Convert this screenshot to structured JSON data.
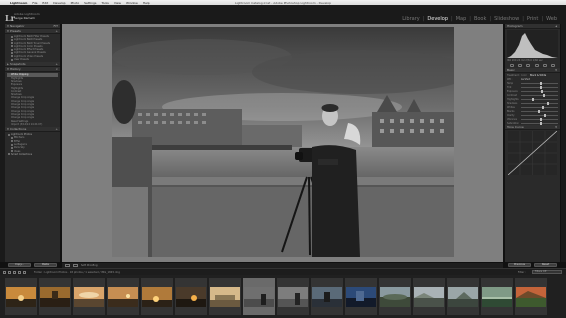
{
  "window": {
    "title": "Lightroom Catalog.lrcat - Adobe Photoshop Lightroom - Develop"
  },
  "menubar": {
    "apple_glyph": "",
    "items": [
      "Lightroom",
      "File",
      "Edit",
      "Develop",
      "Photo",
      "Settings",
      "Tools",
      "View",
      "Window",
      "Help"
    ]
  },
  "identity": {
    "logo": "Lr",
    "catalog_label": "Adobe Lightroom",
    "user_name": "Serge Ramelli"
  },
  "modules": {
    "items": [
      "Library",
      "Develop",
      "Map",
      "Book",
      "Slideshow",
      "Print",
      "Web"
    ],
    "active": "Develop"
  },
  "left_panel": {
    "navigator": {
      "label": "Navigator",
      "zoom": "FIT"
    },
    "presets": {
      "label": "Presets",
      "rows": [
        "Lightroom B&W Filter Presets",
        "Lightroom B&W Presets",
        "Lightroom B&W Toned Presets",
        "Lightroom Color Presets",
        "Lightroom Effect Presets",
        "Lightroom General Presets",
        "Lightroom Video Presets",
        "User Presets"
      ]
    },
    "snapshots": {
      "label": "Snapshots"
    },
    "history": {
      "label": "History",
      "rows": [
        "White Clipping",
        "Highlights",
        "Shadows",
        "Exposure",
        "Highlights",
        "Contrast",
        "Shadows",
        "Change Crop Angle",
        "Change Crop Angle",
        "Change Crop Angle",
        "Change Crop Angle",
        "Change Crop Angle",
        "Change Crop Angle",
        "Change Crop Angle",
        "Reset Settings",
        "Import (3/14/14 14:21:07)"
      ],
      "selected_index": 0
    },
    "collections": {
      "label": "Collections",
      "rows": [
        "Lightroom Photos",
        "BW Paris",
        "Eiffel",
        "Le Bagarre",
        "Paris Sky",
        "Ideas",
        "Smart Collections"
      ]
    },
    "buttons": {
      "copy": "Copy...",
      "paste": "Paste"
    }
  },
  "toolbar": {
    "soft_proofing": "Soft Proofing"
  },
  "right_panel": {
    "histogram_label": "Histogram",
    "histo_info": "ISO 200   24 mm   f/8.0   1/60 sec",
    "original_photo": "Original Photo",
    "basic": {
      "label": "Basic",
      "treatment_label": "Treatment :",
      "treatment_color": "Color",
      "treatment_bw": "Black & White",
      "wb_label": "WB :",
      "wb_value": "As Shot",
      "sliders": [
        "Temp",
        "Tint",
        "Exposure",
        "Contrast",
        "Highlights",
        "Shadows",
        "Whites",
        "Blacks",
        "Clarity",
        "Vibrance",
        "Saturation"
      ]
    },
    "tone_curve": {
      "label": "Tone Curve"
    },
    "buttons": {
      "previous": "Previous",
      "reset": "Reset"
    }
  },
  "filmstrip": {
    "path": "Folder : Lightroom Photos  ·  18 photos / 1 selected / IMG_1845.dng",
    "filter_label": "Filter :",
    "filter_value": "Filters Off",
    "thumbnails": 16,
    "selected_index": 7
  },
  "colors": {
    "accent": "#e6e6e6",
    "panel_bg": "#2a2a2a",
    "canvas_bg": "#7f7f7f"
  }
}
